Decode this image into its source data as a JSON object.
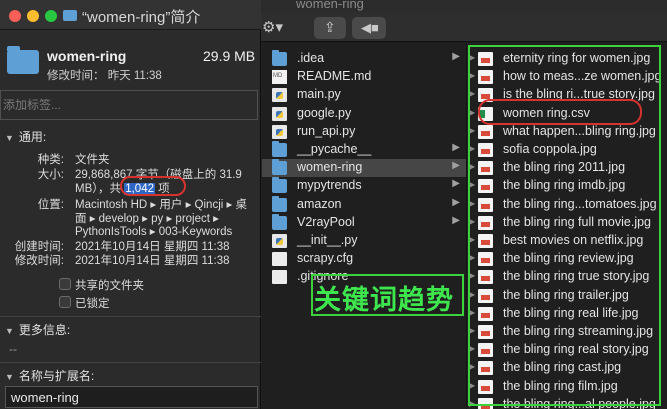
{
  "finder": {
    "title": "women-ring",
    "col1": [
      {
        "name": ".idea",
        "kind": "folder",
        "tri": true
      },
      {
        "name": "README.md",
        "kind": "md"
      },
      {
        "name": "main.py",
        "kind": "py"
      },
      {
        "name": "google.py",
        "kind": "py"
      },
      {
        "name": "run_api.py",
        "kind": "py"
      },
      {
        "name": "__pycache__",
        "kind": "folder",
        "tri": true
      },
      {
        "name": "women-ring",
        "kind": "folder",
        "tri": true,
        "selected": true
      },
      {
        "name": "mypytrends",
        "kind": "folder",
        "tri": true
      },
      {
        "name": "amazon",
        "kind": "folder",
        "tri": true
      },
      {
        "name": "V2rayPool",
        "kind": "folder",
        "tri": true
      },
      {
        "name": "__init__.py",
        "kind": "py"
      },
      {
        "name": "scrapy.cfg",
        "kind": "file"
      },
      {
        "name": ".gitignore",
        "kind": "file"
      }
    ],
    "col2": [
      {
        "name": "eternity ring for women.jpg",
        "kind": "jpg"
      },
      {
        "name": "how to meas...ze women.jpg",
        "kind": "jpg"
      },
      {
        "name": "is the bling ri...true story.jpg",
        "kind": "jpg"
      },
      {
        "name": "women ring.csv",
        "kind": "csv"
      },
      {
        "name": "what happen...bling ring.jpg",
        "kind": "jpg"
      },
      {
        "name": "sofia coppola.jpg",
        "kind": "jpg"
      },
      {
        "name": "the bling ring 2011.jpg",
        "kind": "jpg"
      },
      {
        "name": "the bling ring imdb.jpg",
        "kind": "jpg"
      },
      {
        "name": "the bling ring...tomatoes.jpg",
        "kind": "jpg"
      },
      {
        "name": "the bling ring full movie.jpg",
        "kind": "jpg"
      },
      {
        "name": "best movies on netflix.jpg",
        "kind": "jpg"
      },
      {
        "name": "the bling ring review.jpg",
        "kind": "jpg"
      },
      {
        "name": "the bling ring true story.jpg",
        "kind": "jpg"
      },
      {
        "name": "the bling ring trailer.jpg",
        "kind": "jpg"
      },
      {
        "name": "the bling ring real life.jpg",
        "kind": "jpg"
      },
      {
        "name": "the bling ring streaming.jpg",
        "kind": "jpg"
      },
      {
        "name": "the bling ring real story.jpg",
        "kind": "jpg"
      },
      {
        "name": "the bling ring cast.jpg",
        "kind": "jpg"
      },
      {
        "name": "the bling ring film.jpg",
        "kind": "jpg"
      },
      {
        "name": "the bling ring...al people.jpg",
        "kind": "jpg"
      }
    ]
  },
  "annotation": {
    "overlay_text": "关键词趋势"
  },
  "info": {
    "window_title": "“women-ring”简介",
    "name": "women-ring",
    "size": "29.9 MB",
    "modified_summary": "修改时间： 昨天 11:38",
    "tag_placeholder": "添加标签...",
    "general_header": "通用:",
    "kind_label": "种类:",
    "kind_value": "文件夹",
    "size_label": "大小:",
    "size_line1": "29,868,867 字节（磁盘上的 31.9",
    "size_line2_prefix": "MB），共 ",
    "size_count": "1,042",
    "size_line2_suffix": " 项",
    "where_label": "位置:",
    "where_line1": "Macintosh HD ▸ 用户 ▸ Qincji ▸ 桌",
    "where_line2": "面 ▸ develop ▸ py ▸ project ▸",
    "where_line3": "PythonIsTools ▸ 003-Keywords",
    "created_label": "创建时间:",
    "created_value": "2021年10月14日 星期四 11:38",
    "modified_label": "修改时间:",
    "modified_value": "2021年10月14日 星期四 11:38",
    "shared_folder": "共享的文件夹",
    "locked": "已锁定",
    "more_info_header": "更多信息:",
    "more_info_value": "--",
    "name_ext_header": "名称与扩展名:",
    "name_field_value": "women-ring"
  }
}
